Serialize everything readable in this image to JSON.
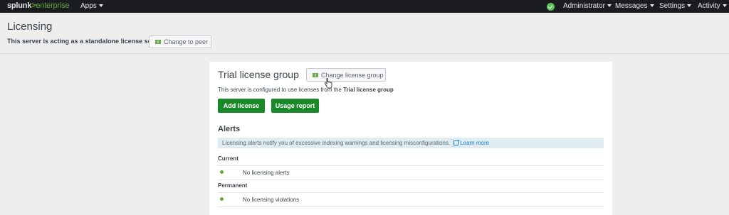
{
  "topbar": {
    "logo_main": "splunk",
    "logo_sep": ">",
    "logo_product": "enterprise",
    "apps_label": "Apps",
    "status_icon": "health-ok-icon",
    "menus": [
      "Administrator",
      "Messages",
      "Settings",
      "Activity"
    ]
  },
  "header": {
    "title": "Licensing",
    "server_mode": "This server is acting as a standalone license server",
    "change_peer_label": "Change to peer"
  },
  "panel": {
    "group_title": "Trial license group",
    "change_group_label": "Change license group",
    "desc_prefix": "This server is configured to use licenses from the",
    "desc_group": "Trial license group",
    "add_license_label": "Add license",
    "usage_report_label": "Usage report",
    "alerts_heading": "Alerts",
    "alerts_info": "Licensing alerts notify you of excessive indexing warnings and licensing misconfigurations.",
    "learn_more": "Learn more",
    "current_heading": "Current",
    "current_item": "No licensing alerts",
    "permanent_heading": "Permanent",
    "permanent_item": "No licensing violations"
  },
  "colors": {
    "topbar_bg": "#1a1c20",
    "brand_green": "#65a637",
    "button_green": "#1a8929",
    "info_bg": "#dfecf1",
    "link_blue": "#1e7fc7"
  }
}
